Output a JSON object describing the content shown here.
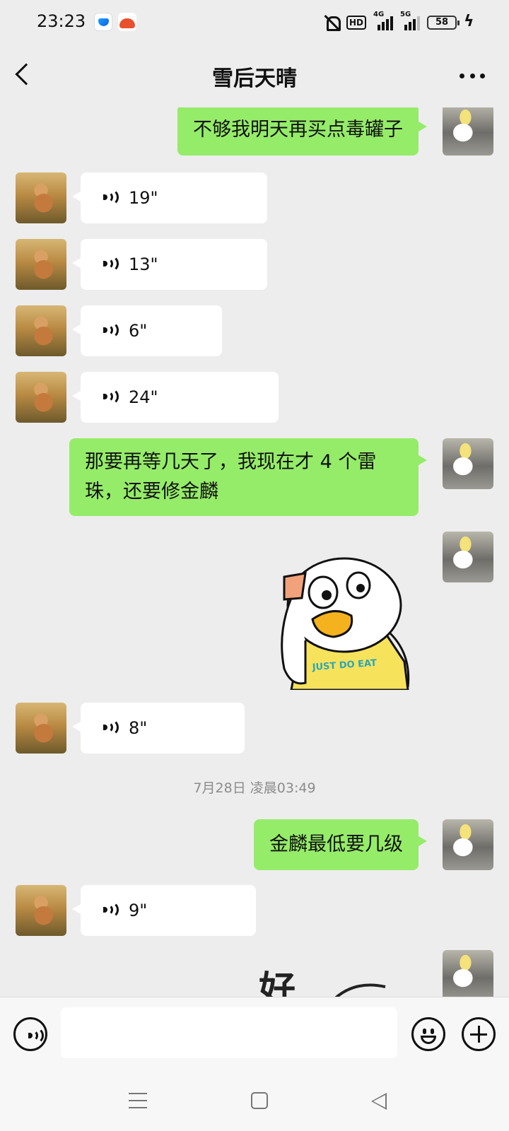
{
  "status_bar": {
    "time": "23:23",
    "hd_label": "HD",
    "net1_label": "4G",
    "net2_label": "5G",
    "battery": "58"
  },
  "header": {
    "title": "雪后天晴"
  },
  "messages": [
    {
      "side": "me",
      "type": "text",
      "text": "不够我明天再买点毒罐子"
    },
    {
      "side": "them",
      "type": "voice",
      "duration": "19\""
    },
    {
      "side": "them",
      "type": "voice",
      "duration": "13\""
    },
    {
      "side": "them",
      "type": "voice",
      "duration": "6\""
    },
    {
      "side": "them",
      "type": "voice",
      "duration": "24\""
    },
    {
      "side": "me",
      "type": "text",
      "text": "那要再等几天了，我现在才 4 个雷珠，还要修金麟"
    },
    {
      "side": "me",
      "type": "sticker",
      "sticker_text": "JUST DO EAT"
    },
    {
      "side": "them",
      "type": "voice",
      "duration": "8\""
    },
    {
      "type": "timestamp",
      "text": "7月28日 凌晨03:49"
    },
    {
      "side": "me",
      "type": "text",
      "text": "金麟最低要几级"
    },
    {
      "side": "them",
      "type": "voice",
      "duration": "9\""
    },
    {
      "side": "me",
      "type": "sticker",
      "sticker_text": "好"
    }
  ],
  "input": {
    "value": "",
    "placeholder": ""
  },
  "colors": {
    "background": "#ededed",
    "my_bubble": "#95ec69",
    "their_bubble": "#ffffff",
    "timestamp": "#8c8c8c"
  }
}
